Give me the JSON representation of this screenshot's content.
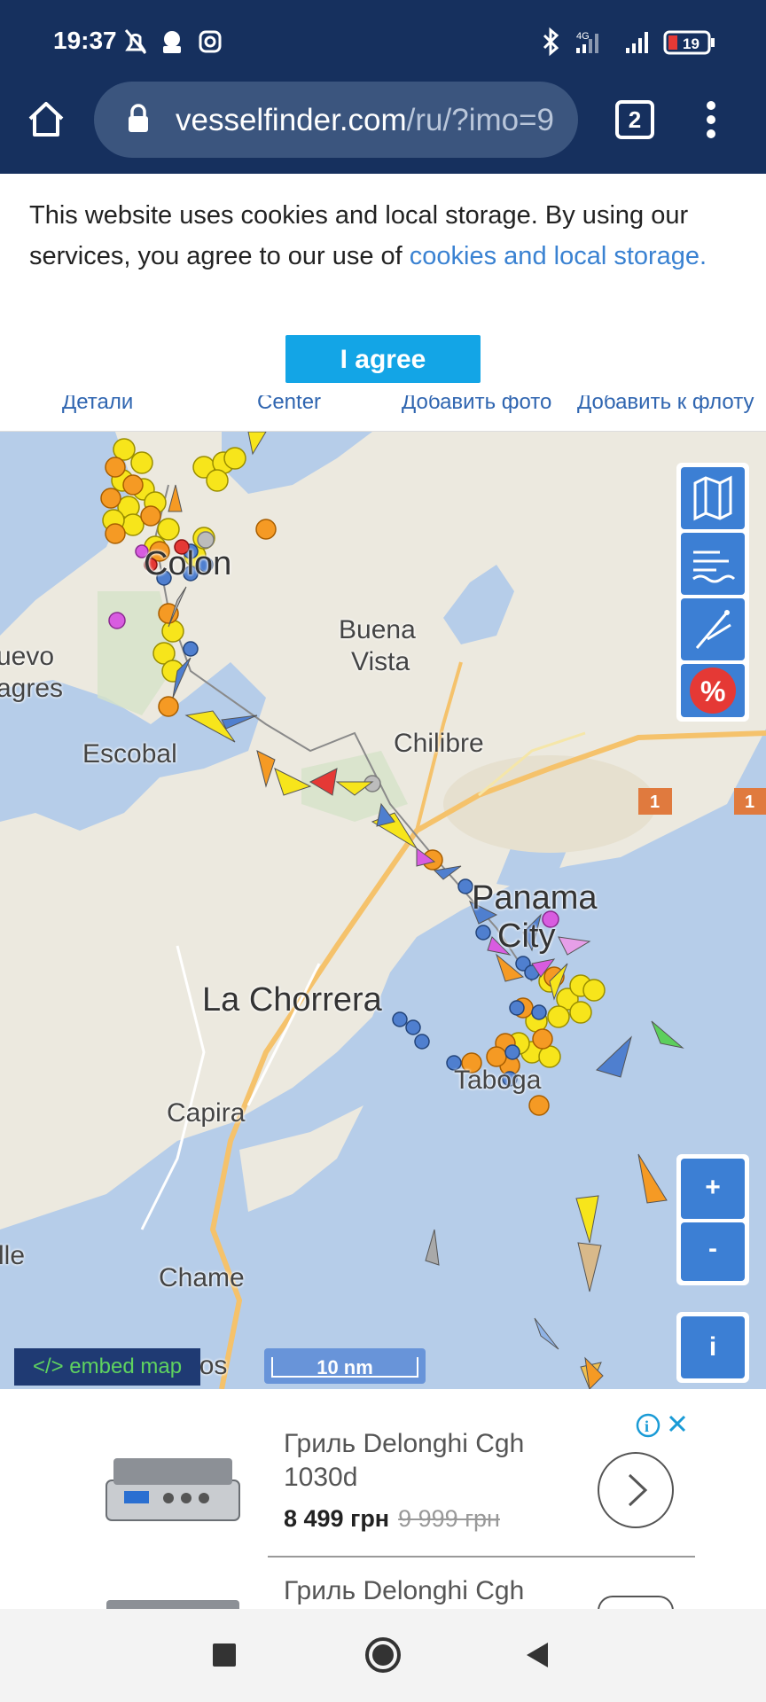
{
  "status_bar": {
    "time": "19:37",
    "network": "4G",
    "battery": "19",
    "icons": [
      "mute-icon",
      "download-icon",
      "instagram-icon",
      "bluetooth-icon",
      "signal-icon",
      "battery-icon"
    ]
  },
  "browser": {
    "url_main": "vesselfinder.com",
    "url_path": "/ru/?imo=9",
    "tab_count": "2"
  },
  "cookie_banner": {
    "text": "This website uses cookies and local storage. By using our services, you agree to our use of ",
    "link": "cookies and local storage.",
    "button": "I agree"
  },
  "tabs": [
    "Детали",
    "Center",
    "Добавить фото",
    "Добавить к флоту"
  ],
  "map": {
    "labels": {
      "colon": "Colon",
      "nuevo": "uevo",
      "chagres": "agres",
      "buena": "Buena",
      "vista": "Vista",
      "escobal": "Escobal",
      "chilibre": "Chilibre",
      "panama": "Panama",
      "city": "City",
      "la_chorrera": "La Chorrera",
      "taboga": "Taboga",
      "capira": "Capira",
      "lle": "lle",
      "chame": "Chame",
      "san_carlos": "San Carlos"
    },
    "road_badge": "1",
    "road_badge2": "1",
    "controls": {
      "zoom_in": "+",
      "zoom_out": "-",
      "info": "i",
      "percent": "%"
    },
    "embed": "</> embed map",
    "scale": "10 nm"
  },
  "ad": {
    "title": "Гриль Delonghi Cgh 1030d",
    "price": "8 499 грн",
    "old_price": "9 999 грн",
    "title2": "Гриль Delonghi Cgh"
  },
  "colors": {
    "status_bg": "#16305e",
    "accent": "#13a5e6",
    "link": "#3a82d2",
    "map_water": "#b6cde9",
    "map_land": "#ece9df"
  }
}
